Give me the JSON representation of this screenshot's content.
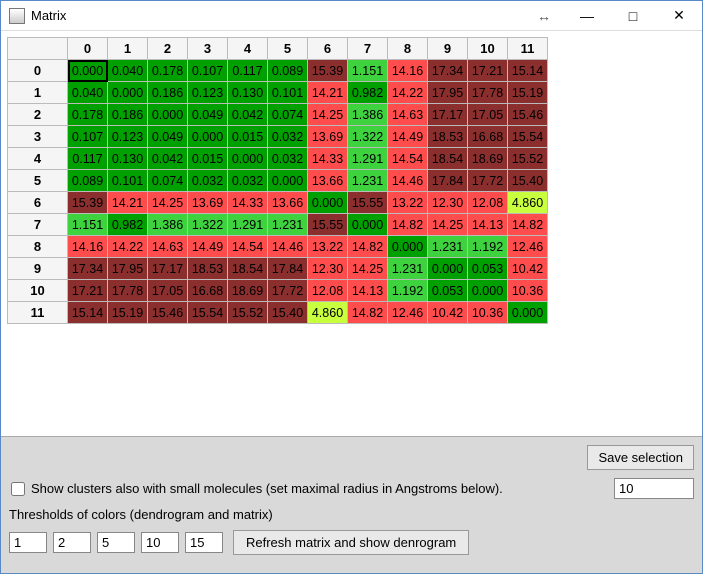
{
  "window": {
    "title": "Matrix"
  },
  "chart_data": {
    "type": "heatmap",
    "col_headers": [
      "0",
      "1",
      "2",
      "3",
      "4",
      "5",
      "6",
      "7",
      "8",
      "9",
      "10",
      "11"
    ],
    "row_headers": [
      "0",
      "1",
      "2",
      "3",
      "4",
      "5",
      "6",
      "7",
      "8",
      "9",
      "10",
      "11"
    ],
    "thresholds": [
      1,
      2,
      5,
      10,
      15
    ],
    "values": [
      [
        0.0,
        0.04,
        0.178,
        0.107,
        0.117,
        0.089,
        15.39,
        1.151,
        14.16,
        17.34,
        17.21,
        15.14
      ],
      [
        0.04,
        0.0,
        0.186,
        0.123,
        0.13,
        0.101,
        14.21,
        0.982,
        14.22,
        17.95,
        17.78,
        15.19
      ],
      [
        0.178,
        0.186,
        0.0,
        0.049,
        0.042,
        0.074,
        14.25,
        1.386,
        14.63,
        17.17,
        17.05,
        15.46
      ],
      [
        0.107,
        0.123,
        0.049,
        0.0,
        0.015,
        0.032,
        13.69,
        1.322,
        14.49,
        18.53,
        16.68,
        15.54
      ],
      [
        0.117,
        0.13,
        0.042,
        0.015,
        0.0,
        0.032,
        14.33,
        1.291,
        14.54,
        18.54,
        18.69,
        15.52
      ],
      [
        0.089,
        0.101,
        0.074,
        0.032,
        0.032,
        0.0,
        13.66,
        1.231,
        14.46,
        17.84,
        17.72,
        15.4
      ],
      [
        15.39,
        14.21,
        14.25,
        13.69,
        14.33,
        13.66,
        0.0,
        15.55,
        13.22,
        12.3,
        12.08,
        4.86
      ],
      [
        1.151,
        0.982,
        1.386,
        1.322,
        1.291,
        1.231,
        15.55,
        0.0,
        14.82,
        14.25,
        14.13,
        14.82
      ],
      [
        14.16,
        14.22,
        14.63,
        14.49,
        14.54,
        14.46,
        13.22,
        14.82,
        0.0,
        1.231,
        1.192,
        12.46
      ],
      [
        17.34,
        17.95,
        17.17,
        18.53,
        18.54,
        17.84,
        12.3,
        14.25,
        1.231,
        0.0,
        0.053,
        10.42
      ],
      [
        17.21,
        17.78,
        17.05,
        16.68,
        18.69,
        17.72,
        12.08,
        14.13,
        1.192,
        0.053,
        0.0,
        10.36
      ],
      [
        15.14,
        15.19,
        15.46,
        15.54,
        15.52,
        15.4,
        4.86,
        14.82,
        12.46,
        10.42,
        10.36,
        0.0
      ]
    ],
    "selected_cell": [
      0,
      0
    ]
  },
  "controls": {
    "save_selection": "Save selection",
    "show_clusters_label": "Show clusters also with small molecules (set maximal radius in Angstroms below).",
    "show_clusters_checked": false,
    "radius_value": "10",
    "thresholds_label": "Thresholds of colors (dendrogram and matrix)",
    "threshold_values": [
      "1",
      "2",
      "5",
      "10",
      "15"
    ],
    "refresh_label": "Refresh matrix and show denrogram"
  }
}
